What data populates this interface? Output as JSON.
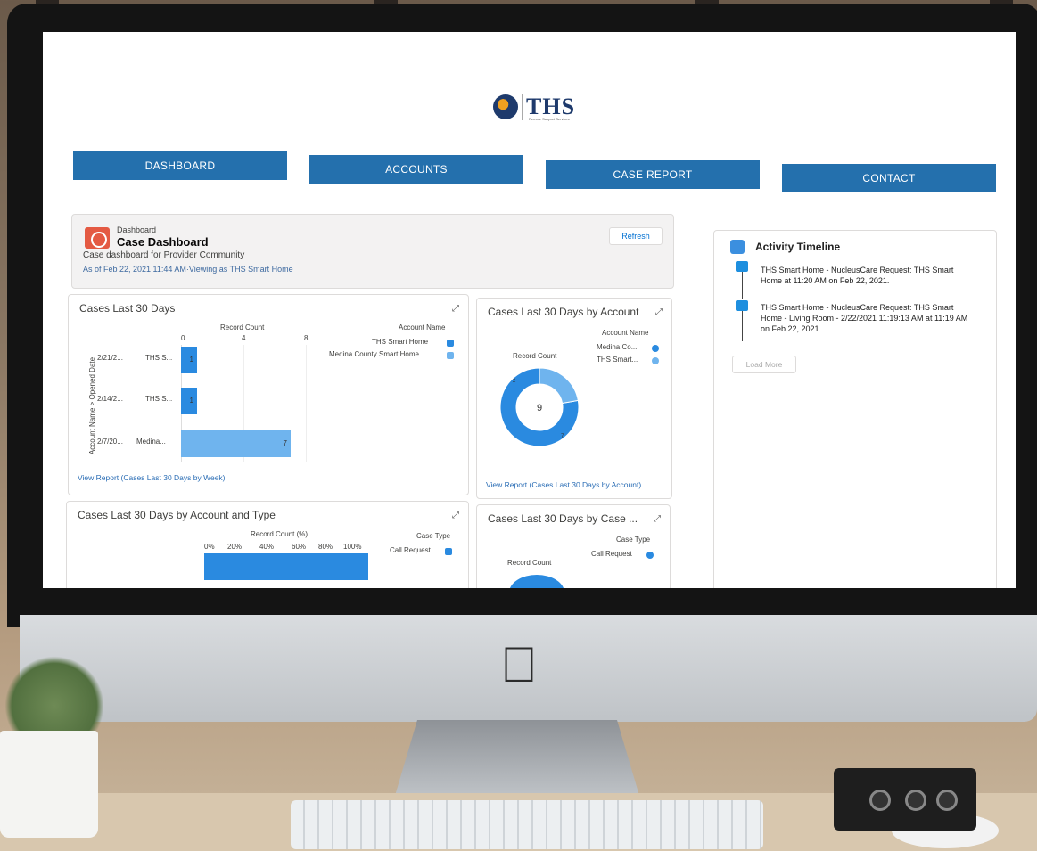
{
  "brand": {
    "logo_text": "THS",
    "tagline": "Remote Support Services"
  },
  "nav": [
    {
      "label": "DASHBOARD"
    },
    {
      "label": "ACCOUNTS"
    },
    {
      "label": "CASE REPORT"
    },
    {
      "label": "CONTACT"
    }
  ],
  "dashboard": {
    "eyebrow": "Dashboard",
    "title": "Case Dashboard",
    "subtitle": "Case dashboard for Provider Community",
    "as_of": "As of Feb 22, 2021 11:44 AM·Viewing as THS Smart Home",
    "refresh_label": "Refresh"
  },
  "cards": {
    "cases30": {
      "title": "Cases Last 30 Days",
      "x_axis_label": "Record Count",
      "y_axis_label": "Account Name > Opened Date",
      "ticks": [
        "0",
        "4",
        "8"
      ],
      "legend_title": "Account Name",
      "legend": [
        "THS Smart Home",
        "Medina County Smart Home"
      ],
      "rows": [
        {
          "date": "2/21/2...",
          "account": "THS S...",
          "value": "1"
        },
        {
          "date": "2/14/2...",
          "account": "THS S...",
          "value": "1"
        },
        {
          "date": "2/7/20...",
          "account": "Medina...",
          "value": "7"
        }
      ],
      "link": "View Report (Cases Last 30 Days by Week)"
    },
    "byAccount": {
      "title": "Cases Last 30 Days by Account",
      "legend_title": "Account Name",
      "legend": [
        "Medina Co...",
        "THS Smart..."
      ],
      "measure_label": "Record Count",
      "center_value": "9",
      "slice_small": "2",
      "slice_large": "7",
      "link": "View Report (Cases Last 30 Days by Account)"
    },
    "byAccountType": {
      "title": "Cases Last 30 Days by Account and Type",
      "x_axis_label": "Record Count (%)",
      "ticks": [
        "0%",
        "20%",
        "40%",
        "60%",
        "80%",
        "100%"
      ],
      "legend_title": "Case Type",
      "legend": [
        "Call Request"
      ]
    },
    "byCase": {
      "title": "Cases Last 30 Days by Case ...",
      "legend_title": "Case Type",
      "legend": [
        "Call Request"
      ],
      "measure_label": "Record Count"
    }
  },
  "timeline": {
    "title": "Activity Timeline",
    "items": [
      "THS Smart Home - NucleusCare Request: THS Smart Home at 11:20 AM on Feb 22, 2021.",
      "THS Smart Home - NucleusCare Request: THS Smart Home - Living Room - 2/22/2021 11:19:13 AM at 11:19 AM on Feb 22, 2021."
    ],
    "load_more": "Load More"
  },
  "chart_data": [
    {
      "type": "bar",
      "title": "Cases Last 30 Days",
      "xlabel": "Record Count",
      "ylabel": "Account Name > Opened Date",
      "categories": [
        "2/21/2... THS S...",
        "2/14/2... THS S...",
        "2/7/20... Medina..."
      ],
      "values": [
        1,
        1,
        7
      ],
      "xlim": [
        0,
        8
      ]
    },
    {
      "type": "pie",
      "title": "Cases Last 30 Days by Account",
      "categories": [
        "Medina Co...",
        "THS Smart..."
      ],
      "values": [
        7,
        2
      ]
    }
  ],
  "colors": {
    "nav": "#2470ad",
    "bar_primary": "#2a8ae0",
    "bar_secondary": "#6fb4ee",
    "donut_dark": "#2a8ae0",
    "donut_light": "#6fb4ee"
  }
}
